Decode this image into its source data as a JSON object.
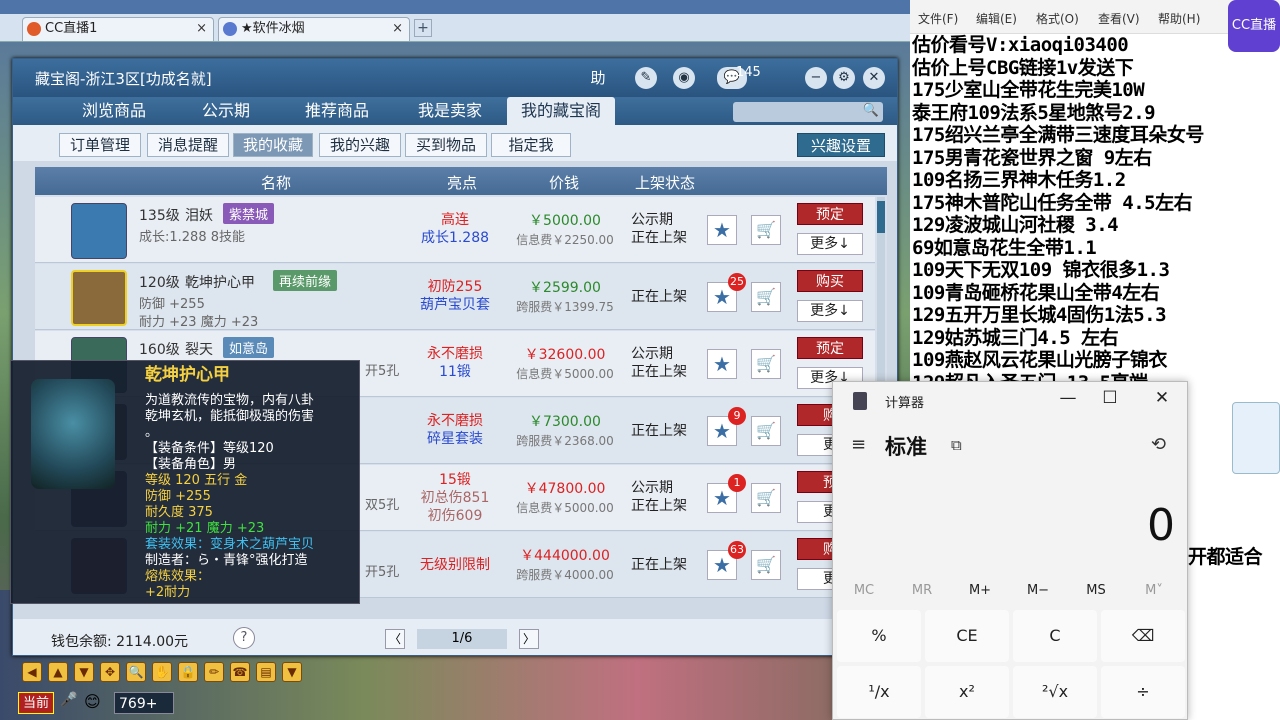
{
  "browser": {
    "tabs": [
      {
        "label": "CC直播1",
        "close": "×"
      },
      {
        "label": "★软件冰烟",
        "close": "×"
      }
    ],
    "new_tab": "+"
  },
  "window": {
    "title": "藏宝阁-浙江3区[功成名就]",
    "title_buttons": [
      "助",
      "✎",
      "◉",
      "💬",
      "−",
      "⚙",
      "✕"
    ],
    "badge": "145",
    "nav_tabs": [
      "浏览商品",
      "公示期",
      "推荐商品",
      "我是卖家",
      "我的藏宝阁"
    ],
    "active_nav": "我的藏宝阁",
    "sub_tabs": [
      "订单管理",
      "消息提醒",
      "我的收藏",
      "我的兴趣",
      "买到物品",
      "指定我"
    ],
    "active_sub": "我的收藏",
    "interest_button": "兴趣设置",
    "columns": [
      "名称",
      "亮点",
      "价钱",
      "上架状态"
    ]
  },
  "rows": [
    {
      "level": "135级",
      "name": "泪妖",
      "tag": "紫禁城",
      "tag_color": "#8a5ab8",
      "stats": [
        "成长:1.288 8技能"
      ],
      "highlight": [
        "高连",
        "成长1.288"
      ],
      "highlight_colors": [
        "#d22",
        "#2a4ad0"
      ],
      "price": "￥5000.00",
      "fee": "信息费￥2250.00",
      "status": [
        "公示期",
        "正在上架"
      ],
      "star": "★",
      "badge": "",
      "cart": "🛒",
      "action": "预定",
      "more": "更多↓",
      "icon_color": "#3a7ab0"
    },
    {
      "level": "120级",
      "name": "乾坤护心甲",
      "tag": "再续前缘",
      "tag_color": "#5a9a6a",
      "stats": [
        "防御 +255",
        "耐力 +23  魔力 +23"
      ],
      "highlight": [
        "初防255",
        "葫芦宝贝套"
      ],
      "highlight_colors": [
        "#d22",
        "#2a4ad0"
      ],
      "price": "￥2599.00",
      "fee": "跨服费￥1399.75",
      "status": [
        "正在上架"
      ],
      "star": "★",
      "badge": "25",
      "cart": "🛒",
      "action": "购买",
      "more": "更多↓",
      "icon_color": "#8a6a3a"
    },
    {
      "level": "160级",
      "name": "裂天",
      "tag": "如意岛",
      "tag_color": "#5a8ab8",
      "stats": [
        "开5孔"
      ],
      "highlight": [
        "永不磨损",
        "11锻"
      ],
      "highlight_colors": [
        "#d22",
        "#2a4ad0"
      ],
      "price": "￥32600.00",
      "fee": "信息费￥5000.00",
      "status": [
        "公示期",
        "正在上架"
      ],
      "star": "★",
      "badge": "",
      "cart": "🛒",
      "action": "预定",
      "more": "更多↓",
      "icon_color": "#3a6a5a"
    },
    {
      "level": "",
      "name": "",
      "tag": "",
      "tag_color": "#5a8ab8",
      "stats": [],
      "highlight": [
        "永不磨损",
        "碎星套装"
      ],
      "highlight_colors": [
        "#d22",
        "#2a4ad0"
      ],
      "price": "￥7300.00",
      "fee": "跨服费￥2368.00",
      "status": [
        "正在上架"
      ],
      "star": "★",
      "badge": "9",
      "cart": "🛒",
      "action": "购",
      "more": "更",
      "icon_color": "#6a4a3a"
    },
    {
      "level": "",
      "name": "",
      "tag": "",
      "tag_color": "#5a8ab8",
      "stats": [
        "双5孔"
      ],
      "highlight": [
        "15锻",
        "初总伤851",
        "初伤609"
      ],
      "highlight_colors": [
        "#d22",
        "#a66",
        "#a66"
      ],
      "price": "￥47800.00",
      "fee": "信息费￥5000.00",
      "status": [
        "公示期",
        "正在上架"
      ],
      "star": "★",
      "badge": "1",
      "cart": "🛒",
      "action": "预",
      "more": "更",
      "icon_color": "#5a4a6a"
    },
    {
      "level": "",
      "name": "",
      "tag": "",
      "tag_color": "#5a8ab8",
      "stats": [
        "开5孔"
      ],
      "highlight": [
        "无级别限制"
      ],
      "highlight_colors": [
        "#d22"
      ],
      "price": "￥444000.00",
      "fee": "跨服费￥4000.00",
      "status": [
        "正在上架"
      ],
      "star": "★",
      "badge": "63",
      "cart": "🛒",
      "action": "购",
      "more": "更",
      "icon_color": "#7a3a3a"
    }
  ],
  "footer": {
    "wallet": "钱包余额: 2114.00元",
    "help": "?",
    "page": "1/6",
    "prev": "〈",
    "next": "〉"
  },
  "tooltip": {
    "title": "乾坤护心甲",
    "lines": [
      {
        "t": "为道教流传的宝物，内有八卦",
        "c": "#ffffff"
      },
      {
        "t": "乾坤玄机，能抵御极强的伤害",
        "c": "#ffffff"
      },
      {
        "t": "。",
        "c": "#ffffff"
      },
      {
        "t": "【装备条件】等级120",
        "c": "#ffffff"
      },
      {
        "t": "【装备角色】男",
        "c": "#ffffff"
      },
      {
        "t": "等级 120  五行 金",
        "c": "#f5d040"
      },
      {
        "t": "防御 +255",
        "c": "#f5d040"
      },
      {
        "t": "耐久度 375",
        "c": "#f5d040"
      },
      {
        "t": "耐力 +21  魔力 +23",
        "c": "#40e040"
      },
      {
        "t": "套装效果：变身术之葫芦宝贝",
        "c": "#40c0f0"
      },
      {
        "t": "制造者：ら・青锋°强化打造",
        "c": "#ffffff"
      },
      {
        "t": "熔炼效果：",
        "c": "#f5d040"
      },
      {
        "t": "+2耐力",
        "c": "#f5d040"
      }
    ]
  },
  "game": {
    "toolbar": [
      "◀",
      "▲",
      "▼",
      "✥",
      "🔍",
      "✋",
      "🔒",
      "✏",
      "☎",
      "▤",
      "▼"
    ],
    "current": "当前",
    "count": "769+"
  },
  "notepad": {
    "menu": [
      "文件(F)",
      "编辑(E)",
      "格式(O)",
      "查看(V)",
      "帮助(H)"
    ],
    "logo": "CC直播",
    "lines": [
      "估价看号V:xiaoqi03400",
      "估价上号CBG链接1v发送下",
      "175少室山全带花生完美10W",
      "泰王府109法系5星地煞号2.9",
      "175绍兴兰亭全满带三速度耳朵女号",
      "175男青花瓷世界之窗  9左右",
      "109名扬三界神木任务1.2",
      "175神木普陀山任务全带 4.5左右",
      "129凌波城山河社稷  3.4",
      "69如意岛花生全带1.1",
      "109天下无双109  锦衣很多1.3",
      "109青岛砸桥花果山全带4左右",
      "129五开万里长城4固伤1法5.3",
      "129姑苏城三门4.5 左右",
      "109燕赵风云花果山光膀子锦衣",
      "129超凡入圣五门  13.5亮端"
    ],
    "trailing": "开都适合"
  },
  "calculator": {
    "title": "计算器",
    "window_controls": [
      "—",
      "☐",
      "✕"
    ],
    "mode": "标准",
    "keep_on_top": "⧉",
    "history": "⟲",
    "menu": "≡",
    "display": "0",
    "memory": [
      "MC",
      "MR",
      "M+",
      "M−",
      "MS",
      "M˅"
    ],
    "keys": [
      [
        "%",
        "CE",
        "C",
        "⌫"
      ],
      [
        "¹/x",
        "x²",
        "²√x",
        "÷"
      ]
    ]
  }
}
